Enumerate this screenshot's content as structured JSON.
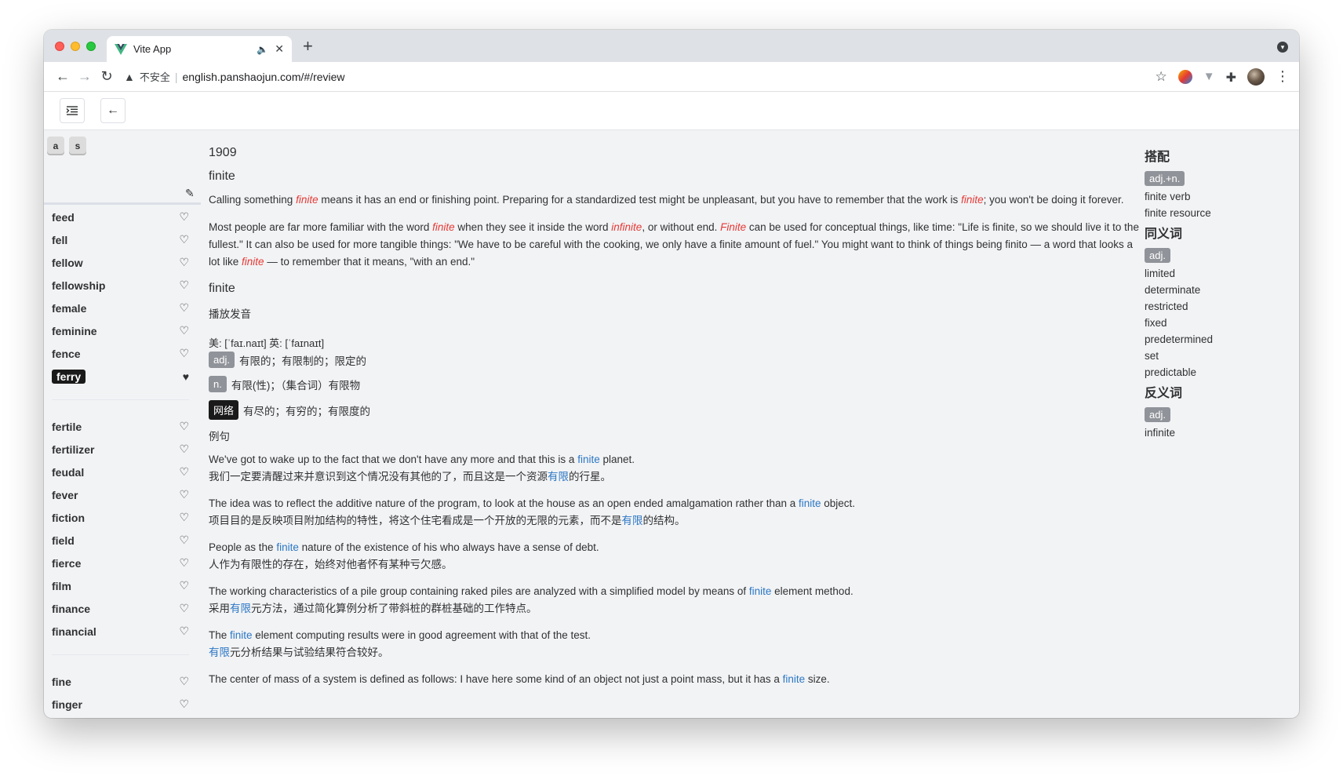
{
  "browser": {
    "tab_title": "Vite App",
    "insecure_label": "不安全",
    "url": "english.panshaojun.com/#/review"
  },
  "sidebar": {
    "keys": [
      "a",
      "s"
    ],
    "groups": [
      [
        {
          "word": "feed",
          "fav": false
        },
        {
          "word": "fell",
          "fav": false
        },
        {
          "word": "fellow",
          "fav": false
        },
        {
          "word": "fellowship",
          "fav": false
        },
        {
          "word": "female",
          "fav": false
        },
        {
          "word": "feminine",
          "fav": false
        },
        {
          "word": "fence",
          "fav": false
        },
        {
          "word": "ferry",
          "fav": true,
          "active": true
        }
      ],
      [
        {
          "word": "fertile",
          "fav": false
        },
        {
          "word": "fertilizer",
          "fav": false
        },
        {
          "word": "feudal",
          "fav": false
        },
        {
          "word": "fever",
          "fav": false
        },
        {
          "word": "fiction",
          "fav": false
        },
        {
          "word": "field",
          "fav": false
        },
        {
          "word": "fierce",
          "fav": false
        },
        {
          "word": "film",
          "fav": false
        },
        {
          "word": "finance",
          "fav": false
        },
        {
          "word": "financial",
          "fav": false
        }
      ],
      [
        {
          "word": "fine",
          "fav": false
        },
        {
          "word": "finger",
          "fav": false
        }
      ]
    ]
  },
  "main": {
    "number": "1909",
    "word": "finite",
    "paragraphs": [
      [
        {
          "t": "Calling something "
        },
        {
          "t": "finite",
          "hl": true
        },
        {
          "t": " means it has an end or finishing point. Preparing for a standardized test might be unpleasant, but you have to remember that the work is "
        },
        {
          "t": "finite",
          "hl": true
        },
        {
          "t": "; you won't be doing it forever."
        }
      ],
      [
        {
          "t": "Most people are far more familiar with the word "
        },
        {
          "t": "finite",
          "hl": true
        },
        {
          "t": " when they see it inside the word "
        },
        {
          "t": "infinite",
          "hl": true
        },
        {
          "t": ", or without end. "
        },
        {
          "t": "Finite",
          "hl": true
        },
        {
          "t": " can be used for conceptual things, like time: \"Life is finite, so we should live it to the fullest.\" It can also be used for more tangible things: \"We have to be careful with the cooking, we only have a finite amount of fuel.\" You might want to think of things being finito — a word that looks a lot like "
        },
        {
          "t": "finite",
          "hl": true
        },
        {
          "t": " — to remember that it means, \"with an end.\""
        }
      ]
    ],
    "word2": "finite",
    "play_label": "播放发音",
    "phonetic": "美: [ˈfaɪ.naɪt] 英: [ˈfaɪnaɪt]",
    "definitions": [
      {
        "pos": "adj.",
        "text": "有限的；有限制的；限定的",
        "dark": false
      },
      {
        "pos": "n.",
        "text": "有限(性)；（集合词）有限物",
        "dark": false
      },
      {
        "pos": "网络",
        "text": "有尽的；有穷的；有限度的",
        "dark": true
      }
    ],
    "examples_label": "例句",
    "examples": [
      {
        "en": [
          {
            "t": "We've got to wake up to the fact that we don't have any more and that this is a "
          },
          {
            "t": "finite",
            "kw": true
          },
          {
            "t": " planet."
          }
        ],
        "zh": [
          {
            "t": "我们一定要清醒过来并意识到这个情况没有其他的了，而且这是一个资源"
          },
          {
            "t": "有限",
            "kw": true
          },
          {
            "t": "的行星。"
          }
        ]
      },
      {
        "en": [
          {
            "t": "The idea was to reflect the additive nature of the program, to look at the house as an open ended amalgamation rather than a "
          },
          {
            "t": "finite",
            "kw": true
          },
          {
            "t": " object."
          }
        ],
        "zh": [
          {
            "t": "项目目的是反映项目附加结构的特性，将这个住宅看成是一个开放的无限的元素，而不是"
          },
          {
            "t": "有限",
            "kw": true
          },
          {
            "t": "的结构。"
          }
        ]
      },
      {
        "en": [
          {
            "t": "People as the "
          },
          {
            "t": "finite",
            "kw": true
          },
          {
            "t": " nature of the existence of his who always have a sense of debt."
          }
        ],
        "zh": [
          {
            "t": "人作为有限性的存在，始终对他者怀有某种亏欠感。"
          }
        ]
      },
      {
        "en": [
          {
            "t": "The working characteristics of a pile group containing raked piles are analyzed with a simplified model by means of "
          },
          {
            "t": "finite",
            "kw": true
          },
          {
            "t": " element method."
          }
        ],
        "zh": [
          {
            "t": "采用"
          },
          {
            "t": "有限",
            "kw": true
          },
          {
            "t": "元方法，通过简化算例分析了带斜桩的群桩基础的工作特点。"
          }
        ]
      },
      {
        "en": [
          {
            "t": "The "
          },
          {
            "t": "finite",
            "kw": true
          },
          {
            "t": " element computing results were in good agreement with that of the test."
          }
        ],
        "zh": [
          {
            "t": "有限",
            "kw": true
          },
          {
            "t": "元分析结果与试验结果符合较好。"
          }
        ]
      },
      {
        "en": [
          {
            "t": "The center of mass of a system is defined as follows: I have here some kind of an object not just a point mass, but it has a "
          },
          {
            "t": "finite",
            "kw": true
          },
          {
            "t": " size."
          }
        ],
        "zh": []
      }
    ]
  },
  "right": {
    "sections": [
      {
        "title": "搭配",
        "tag": "adj.+n.",
        "items": [
          "finite verb",
          "finite resource"
        ]
      },
      {
        "title": "同义词",
        "tag": "adj.",
        "items": [
          "limited",
          "determinate",
          "restricted",
          "fixed",
          "predetermined",
          "set",
          "predictable"
        ]
      },
      {
        "title": "反义词",
        "tag": "adj.",
        "items": [
          "infinite"
        ]
      }
    ]
  }
}
